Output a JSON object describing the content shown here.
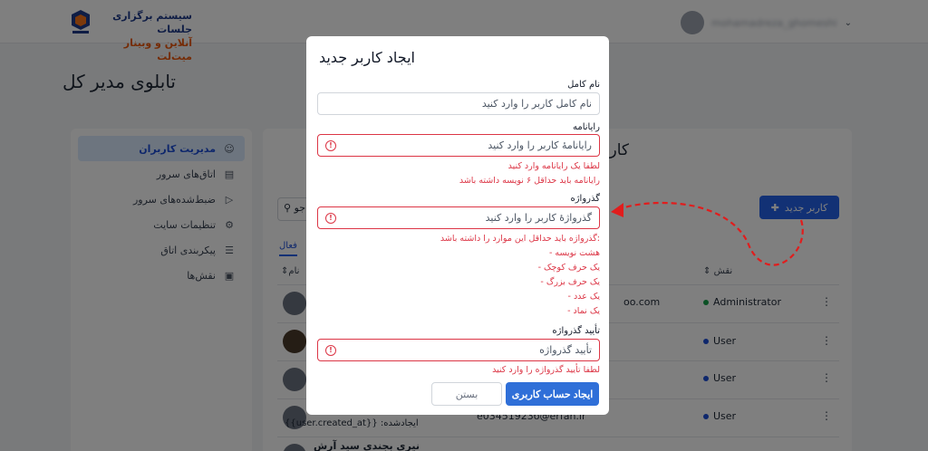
{
  "brand": {
    "line1": "سیستم برگزاری جلسات",
    "line2": "آنلاین و وبینار میت‌لت"
  },
  "user_menu": {
    "username": "mohamadreza_ghomeshi"
  },
  "page_title": "تابلوی مدیر کل",
  "sidebar": {
    "items": [
      {
        "label": "مدیریت کاربران",
        "icon": "users-icon",
        "active": true
      },
      {
        "label": "اتاق‌های سرور",
        "icon": "server-icon",
        "active": false
      },
      {
        "label": "ضبط‌شده‌های سرور",
        "icon": "video-icon",
        "active": false
      },
      {
        "label": "تنظیمات سایت",
        "icon": "gear-icon",
        "active": false
      },
      {
        "label": "پیکربندی اتاق",
        "icon": "sliders-icon",
        "active": false
      },
      {
        "label": "نقش‌ها",
        "icon": "id-card-icon",
        "active": false
      }
    ]
  },
  "main": {
    "section_title": "کاربران",
    "new_user_button": "کاربر جدید",
    "search_value": "جو",
    "tab_label": "فعال",
    "columns": {
      "name": "نام",
      "role": "نقش"
    },
    "rows": [
      {
        "email": "oo.com",
        "role": "Administrator",
        "role_color": "#16a34a"
      },
      {
        "email": "",
        "role": "User",
        "role_color": "#1d4ed8"
      },
      {
        "email": "",
        "role": "User",
        "role_color": "#1d4ed8"
      },
      {
        "email": "e03451923б@erfan.ir",
        "created": "ایجادشده: {{user.created_at}}",
        "role": "User",
        "role_color": "#1d4ed8"
      },
      {
        "name": "نیری بجندی سید آرش",
        "role": "",
        "role_color": ""
      }
    ]
  },
  "modal": {
    "title": "ایجاد کاربر جدید",
    "fullname": {
      "label": "نام کامل",
      "placeholder": "نام کامل کاربر را وارد کنید"
    },
    "email": {
      "label": "رایانامه",
      "placeholder": "رایانامهٔ کاربر را وارد کنید",
      "errors": [
        "لطفا یک رایانامه وارد کنید",
        "رایانامه باید حداقل ۶ نویسه داشته باشد"
      ]
    },
    "password": {
      "label": "گذرواژه",
      "placeholder": "گذرواژهٔ کاربر را وارد کنید",
      "errors": [
        ":گذرواژه باید حداقل این موارد را داشته باشد",
        "هشت نویسه -",
        "یک حرف کوچک -",
        "یک حرف بزرگ -",
        "یک عدد -",
        "یک نماد -"
      ]
    },
    "confirm": {
      "label": "تأیید گذرواژه",
      "placeholder": "تأیید گذرواژه",
      "errors": [
        "لطفا تأیید گذرواژه را وارد کنید"
      ]
    },
    "submit_label": "ایجاد حساب کاربری",
    "close_label": "بستن"
  },
  "colors": {
    "primary": "#2563eb",
    "error": "#dc3545",
    "arrow": "#e11d1d"
  }
}
